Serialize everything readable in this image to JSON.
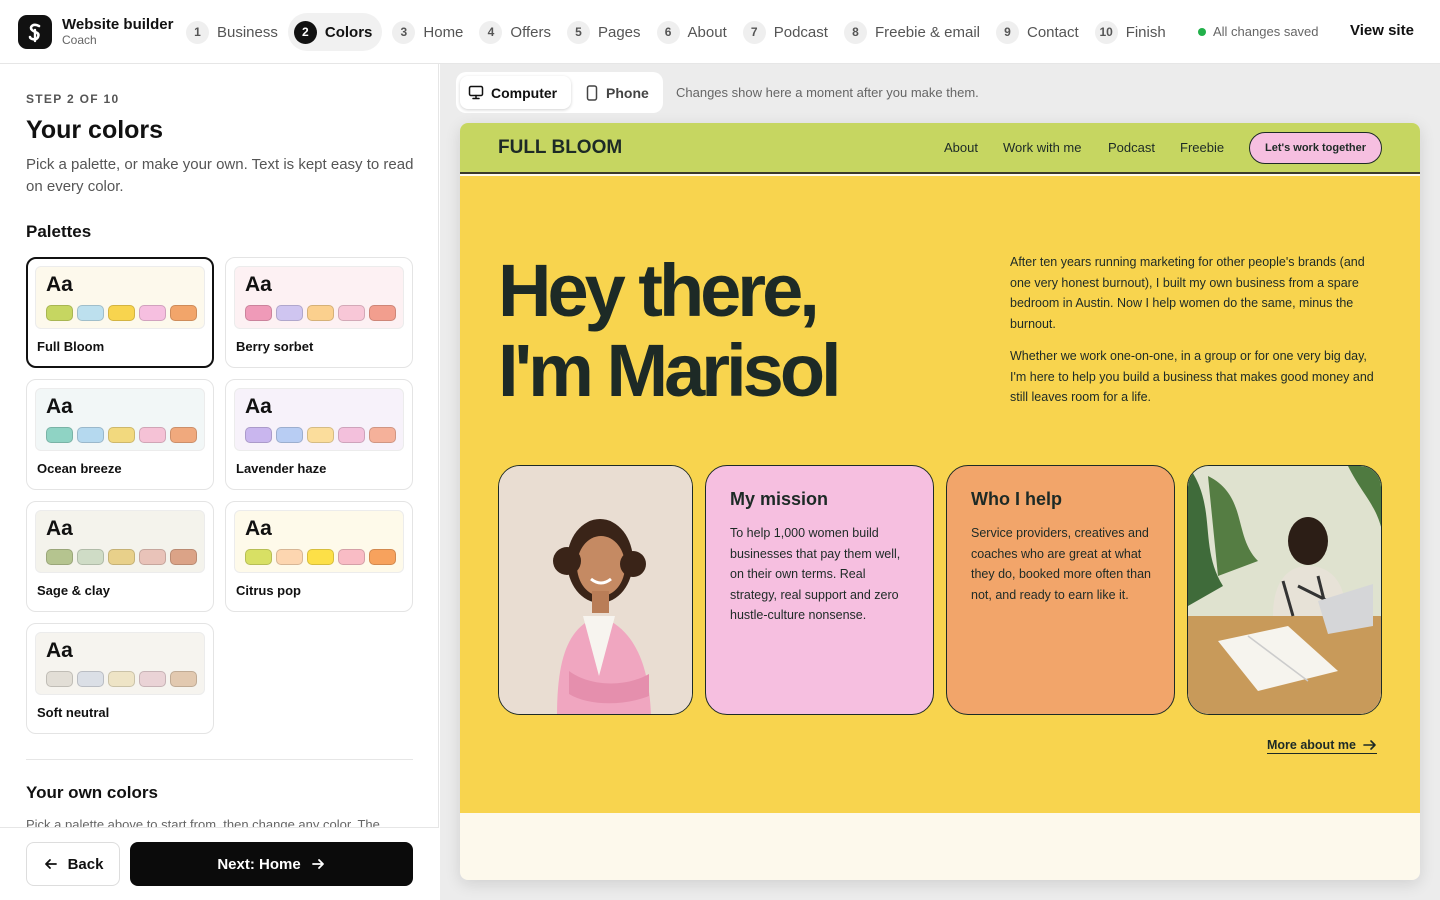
{
  "app": {
    "title": "Website builder",
    "subtitle": "Coach"
  },
  "steps": [
    {
      "num": "1",
      "label": "Business"
    },
    {
      "num": "2",
      "label": "Colors"
    },
    {
      "num": "3",
      "label": "Home"
    },
    {
      "num": "4",
      "label": "Offers"
    },
    {
      "num": "5",
      "label": "Pages"
    },
    {
      "num": "6",
      "label": "About"
    },
    {
      "num": "7",
      "label": "Podcast"
    },
    {
      "num": "8",
      "label": "Freebie & email"
    },
    {
      "num": "9",
      "label": "Contact"
    },
    {
      "num": "10",
      "label": "Finish"
    }
  ],
  "active_step": "2",
  "status": {
    "saved": "All changes saved"
  },
  "header": {
    "view_site": "View site"
  },
  "panel": {
    "step_of": "STEP 2 OF 10",
    "title": "Your colors",
    "description": "Pick a palette, or make your own. Text is kept easy to read on every color.",
    "palettes_title": "Palettes",
    "own_title": "Your own colors",
    "own_description": "Pick a palette above to start from, then change any color. The"
  },
  "palettes": [
    {
      "name": "Full Bloom",
      "sample": "Aa",
      "selected": true,
      "bg": "#fdf9ec",
      "colors": [
        "#c6d661",
        "#bde0ee",
        "#f8d44e",
        "#f6bfe0",
        "#f2a56a"
      ]
    },
    {
      "name": "Berry sorbet",
      "sample": "Aa",
      "selected": false,
      "bg": "#fdf1f3",
      "colors": [
        "#ef9ab8",
        "#cfc5f0",
        "#fbd08e",
        "#f8c7d7",
        "#f29e8e"
      ]
    },
    {
      "name": "Ocean breeze",
      "sample": "Aa",
      "selected": false,
      "bg": "#f2f7f7",
      "colors": [
        "#8fd3c4",
        "#b5d9ef",
        "#f2d97e",
        "#f5c2d6",
        "#f0a97d"
      ]
    },
    {
      "name": "Lavender haze",
      "sample": "Aa",
      "selected": false,
      "bg": "#f7f2fa",
      "colors": [
        "#c9b6ee",
        "#b8cdf3",
        "#fbdd9c",
        "#f3c0dc",
        "#f5b19a"
      ]
    },
    {
      "name": "Sage & clay",
      "sample": "Aa",
      "selected": false,
      "bg": "#f4f3ec",
      "colors": [
        "#b5c48f",
        "#cfdcc6",
        "#e8d08a",
        "#e9c3b9",
        "#dba387"
      ]
    },
    {
      "name": "Citrus pop",
      "sample": "Aa",
      "selected": false,
      "bg": "#fefaea",
      "colors": [
        "#d8e064",
        "#fdd6b0",
        "#fde047",
        "#f9bcc5",
        "#f7a25d"
      ]
    },
    {
      "name": "Soft neutral",
      "sample": "Aa",
      "selected": false,
      "bg": "#f6f4ef",
      "colors": [
        "#e2ded6",
        "#dbdfe6",
        "#eee4c6",
        "#ead3d6",
        "#e2c9b0"
      ]
    }
  ],
  "footer": {
    "back_label": "Back",
    "next_label": "Next: Home"
  },
  "preview": {
    "device_computer": "Computer",
    "device_phone": "Phone",
    "hint": "Changes show here a moment after you make them."
  },
  "site": {
    "brand": "FULL BLOOM",
    "nav": [
      "About",
      "Work with me",
      "Podcast",
      "Freebie"
    ],
    "cta": "Let's work together",
    "hero_line1": "Hey there,",
    "hero_line2": "I'm Marisol",
    "para1": "After ten years running marketing for other people's brands (and one very honest burnout), I built my own business from a spare bedroom in Austin. Now I help women do the same, minus the burnout.",
    "para2": "Whether we work one-on-one, in a group or for one very big day, I'm here to help you build a business that makes good money and still leaves room for a life.",
    "mission_title": "My mission",
    "mission_text": "To help 1,000 women build businesses that pay them well, on their own terms. Real strategy, real support and zero hustle-culture nonsense.",
    "help_title": "Who I help",
    "help_text": "Service providers, creatives and coaches who are great at what they do, booked more often than not, and ready to earn like it.",
    "more": "More about me"
  },
  "icons": [
    "logo-icon",
    "computer-icon",
    "phone-icon",
    "arrow-left-icon",
    "arrow-right-icon"
  ]
}
